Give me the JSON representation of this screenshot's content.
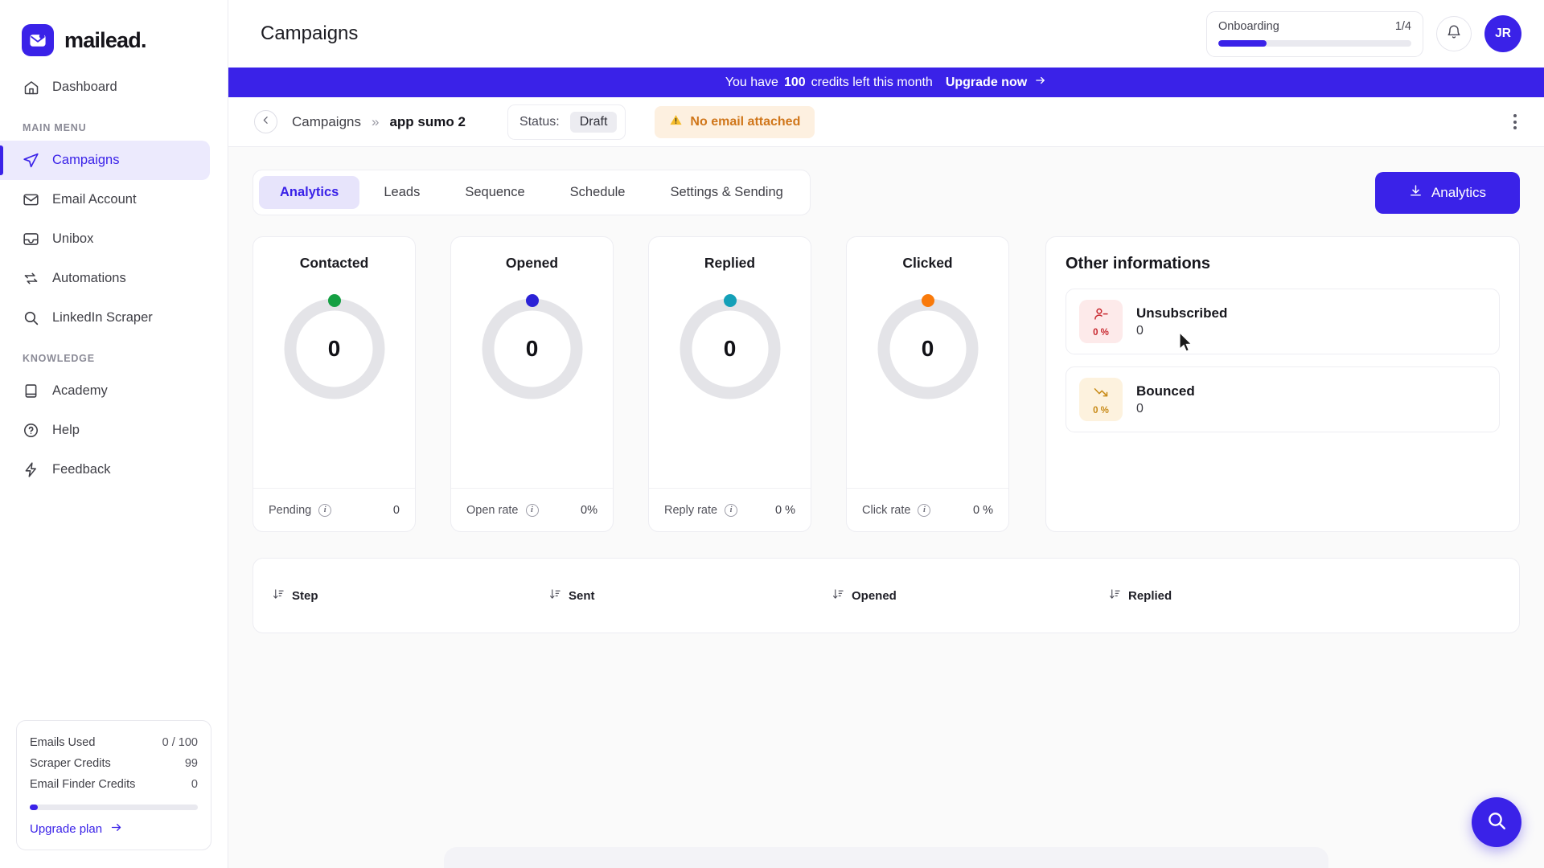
{
  "brand": {
    "name": "mailead.",
    "logo_icon": "envelope-icon",
    "accent": "#3a22e8"
  },
  "sidebar": {
    "top_items": [
      {
        "label": "Dashboard",
        "icon": "home-icon",
        "active": false
      }
    ],
    "sections": [
      {
        "title": "MAIN MENU",
        "items": [
          {
            "label": "Campaigns",
            "icon": "send-icon",
            "active": true
          },
          {
            "label": "Email Account",
            "icon": "mail-icon",
            "active": false
          },
          {
            "label": "Unibox",
            "icon": "inbox-icon",
            "active": false
          },
          {
            "label": "Automations",
            "icon": "repeat-icon",
            "active": false
          },
          {
            "label": "LinkedIn Scraper",
            "icon": "search-icon",
            "active": false
          }
        ]
      },
      {
        "title": "KNOWLEDGE",
        "items": [
          {
            "label": "Academy",
            "icon": "book-icon",
            "active": false
          },
          {
            "label": "Help",
            "icon": "question-circle-icon",
            "active": false
          },
          {
            "label": "Feedback",
            "icon": "bolt-icon",
            "active": false
          }
        ]
      }
    ],
    "usage": {
      "rows": [
        {
          "label": "Emails Used",
          "value": "0 / 100"
        },
        {
          "label": "Scraper Credits",
          "value": "99"
        },
        {
          "label": "Email Finder Credits",
          "value": "0"
        }
      ],
      "progress_percent": 5,
      "upgrade_label": "Upgrade plan",
      "upgrade_icon": "arrow-right-icon"
    }
  },
  "header": {
    "title": "Campaigns",
    "onboarding": {
      "label": "Onboarding",
      "count": "1/4",
      "progress_percent": 25
    },
    "bell_icon": "bell-icon",
    "avatar_initials": "JR"
  },
  "banner": {
    "prefix": "You have",
    "credits": "100",
    "suffix": "credits left this month",
    "cta": "Upgrade now",
    "cta_icon": "arrow-right-icon",
    "background": "#3a22e8"
  },
  "subheader": {
    "back_icon": "chevron-left-icon",
    "breadcrumb_parent": "Campaigns",
    "breadcrumb_separator": "»",
    "breadcrumb_current": "app sumo 2",
    "status_label": "Status:",
    "status_value": "Draft",
    "warning_icon": "warning-triangle-icon",
    "warning_text": "No email attached",
    "menu_icon": "kebab-menu-icon"
  },
  "tabs": [
    {
      "label": "Analytics",
      "active": true
    },
    {
      "label": "Leads",
      "active": false
    },
    {
      "label": "Sequence",
      "active": false
    },
    {
      "label": "Schedule",
      "active": false
    },
    {
      "label": "Settings & Sending",
      "active": false
    }
  ],
  "analytics_button": {
    "label": "Analytics",
    "icon": "download-icon"
  },
  "chart_data": {
    "type": "pie",
    "title": "Campaign analytics donuts",
    "charts": [
      {
        "name": "Contacted",
        "value": 0,
        "percent": 0,
        "color": "#15a043",
        "footer_label": "Pending",
        "footer_value": "0",
        "footer_icon": "info-icon"
      },
      {
        "name": "Opened",
        "value": 0,
        "percent": 0,
        "color": "#2b22d6",
        "footer_label": "Open rate",
        "footer_value": "0%",
        "footer_icon": "info-icon"
      },
      {
        "name": "Replied",
        "value": 0,
        "percent": 0,
        "color": "#14a0b8",
        "footer_label": "Reply rate",
        "footer_value": "0 %",
        "footer_icon": "info-icon"
      },
      {
        "name": "Clicked",
        "value": 0,
        "percent": 0,
        "color": "#f97a0b",
        "footer_label": "Click rate",
        "footer_value": "0 %",
        "footer_icon": "info-icon"
      }
    ],
    "track_color": "#e4e4e8",
    "legend_position": "none",
    "grid": false
  },
  "other_info": {
    "title": "Other informations",
    "rows": [
      {
        "name": "Unsubscribed",
        "count": "0",
        "percent": "0 %",
        "icon": "user-minus-icon",
        "bg": "#fdeaea",
        "fg": "#c8282f"
      },
      {
        "name": "Bounced",
        "count": "0",
        "percent": "0 %",
        "icon": "trend-down-icon",
        "bg": "#fdf2de",
        "fg": "#c88a16"
      }
    ]
  },
  "steps_table": {
    "columns": [
      {
        "label": "Step",
        "sort_icon": "sort-icon"
      },
      {
        "label": "Sent",
        "sort_icon": "sort-icon"
      },
      {
        "label": "Opened",
        "sort_icon": "sort-icon"
      },
      {
        "label": "Replied",
        "sort_icon": "sort-icon"
      }
    ],
    "rows": []
  },
  "fab": {
    "icon": "search-icon"
  }
}
